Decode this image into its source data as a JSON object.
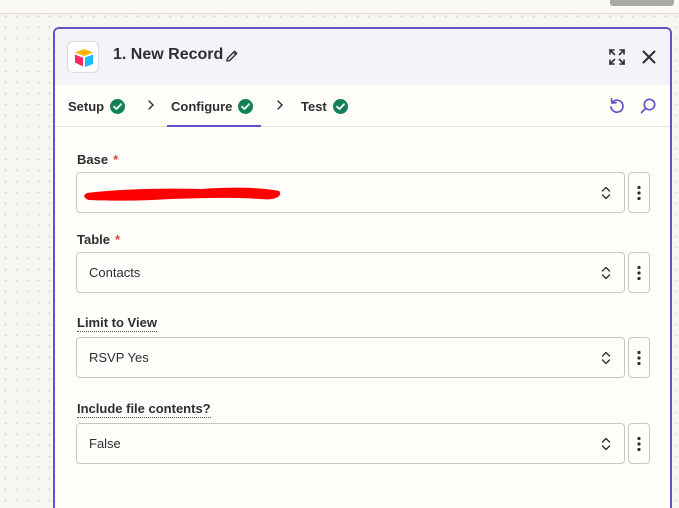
{
  "panel": {
    "title": "1. New Record",
    "app_icon": "airtable-logo",
    "accent_color": "#5f54c7"
  },
  "tabs": [
    {
      "label": "Setup",
      "status": "complete"
    },
    {
      "label": "Configure",
      "status": "complete",
      "active": true
    },
    {
      "label": "Test",
      "status": "complete"
    }
  ],
  "fields": {
    "base": {
      "label": "Base",
      "required": true,
      "value": ""
    },
    "table": {
      "label": "Table",
      "required": true,
      "value": "Contacts"
    },
    "view": {
      "label": "Limit to View",
      "required": false,
      "value": "RSVP Yes"
    },
    "file_contents": {
      "label": "Include file contents?",
      "required": false,
      "value": "False"
    }
  },
  "required_marker": "*",
  "icons": {
    "edit": "pencil-icon",
    "expand": "expand-icon",
    "close": "close-icon",
    "undo": "undo-icon",
    "search": "search-icon",
    "check": "check-circle-icon",
    "caret": "up-down-caret-icon",
    "more": "vertical-dots-icon"
  },
  "colors": {
    "success": "#128056",
    "required": "#e5483b",
    "redaction": "#ff0000"
  }
}
